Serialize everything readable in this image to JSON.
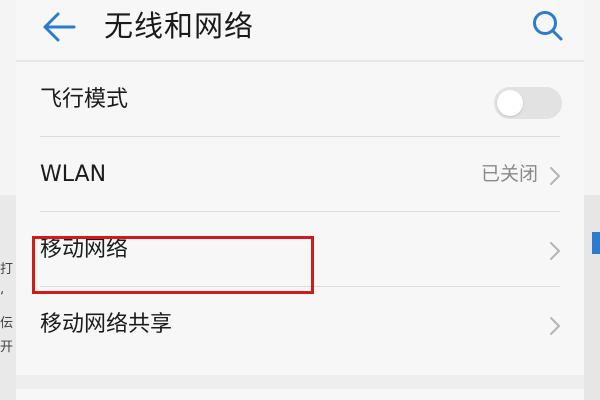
{
  "header": {
    "title": "无线和网络",
    "back_icon": "back-arrow-icon",
    "search_icon": "search-icon"
  },
  "settings": [
    {
      "label": "飞行模式",
      "control": "toggle",
      "toggle_on": false
    },
    {
      "label": "WLAN",
      "control": "chevron",
      "status": "已关闭"
    },
    {
      "label": "移动网络",
      "control": "chevron"
    },
    {
      "label": "移动网络共享",
      "control": "chevron",
      "highlighted": true
    }
  ],
  "background": {
    "left_fragments": [
      "打",
      "‘",
      "伝",
      "开"
    ]
  },
  "colors": {
    "accent": "#2b7bd0",
    "highlight": "#d31a1a",
    "text": "#1c1c1c",
    "secondary_text": "#8a8a8a"
  }
}
